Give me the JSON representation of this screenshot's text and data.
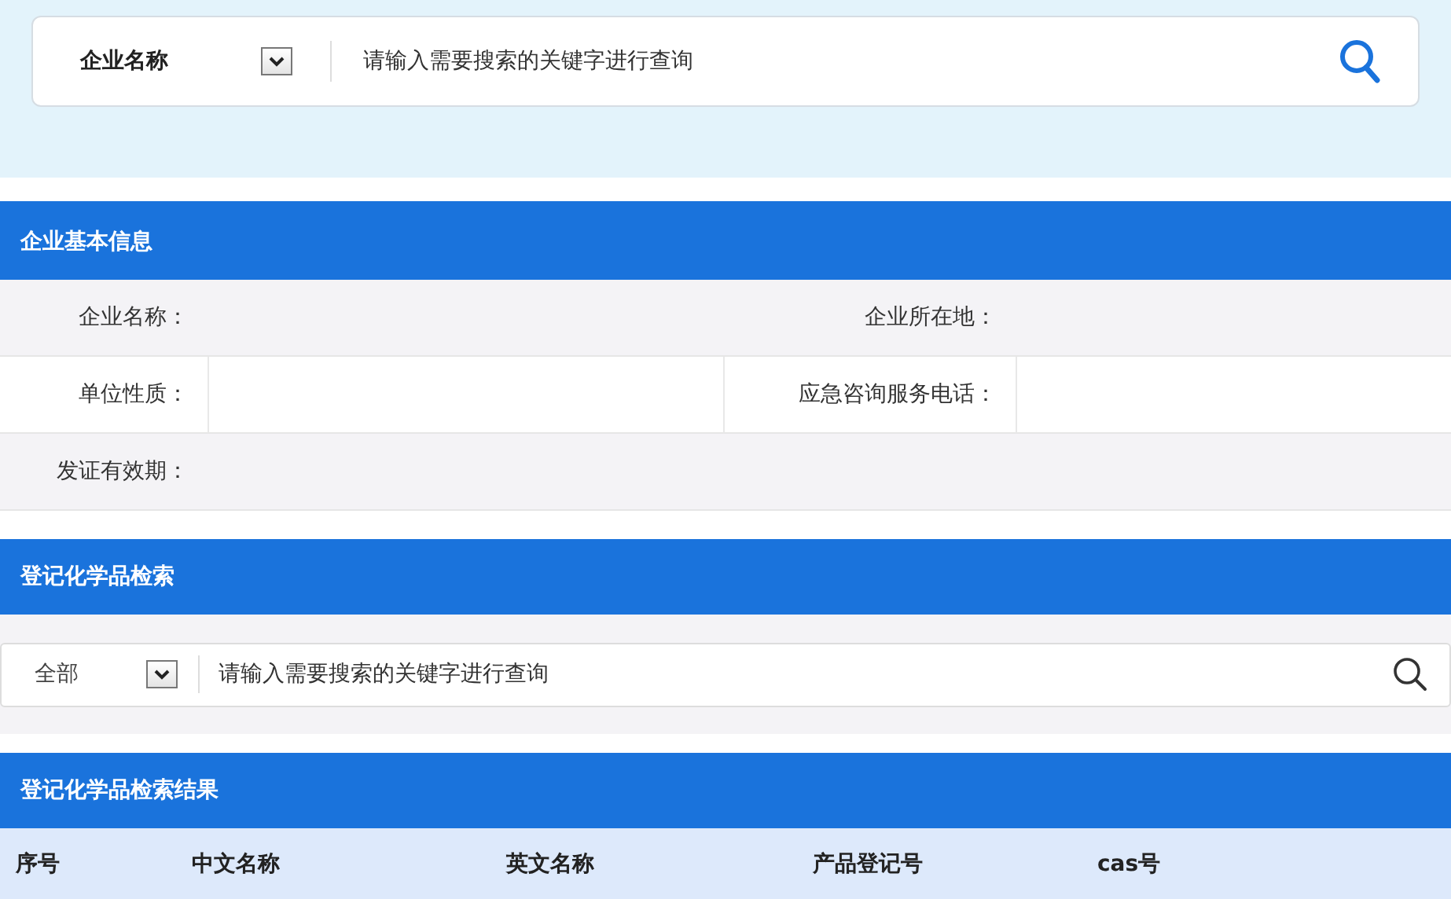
{
  "company_search": {
    "scope": "企业名称",
    "placeholder": "请输入需要搜索的关键字进行查询"
  },
  "basic_info": {
    "title": "企业基本信息",
    "fields": [
      {
        "label": "企业名称："
      },
      {
        "label": "企业所在地："
      },
      {
        "label": "单位性质："
      },
      {
        "label": "应急咨询服务电话："
      },
      {
        "label": "发证有效期："
      }
    ]
  },
  "chemical_search": {
    "title": "登记化学品检索",
    "scope": "全部",
    "placeholder": "请输入需要搜索的关键字进行查询"
  },
  "results": {
    "title": "登记化学品检索结果",
    "columns": [
      "序号",
      "中文名称",
      "英文名称",
      "产品登记号",
      "cas号"
    ]
  }
}
